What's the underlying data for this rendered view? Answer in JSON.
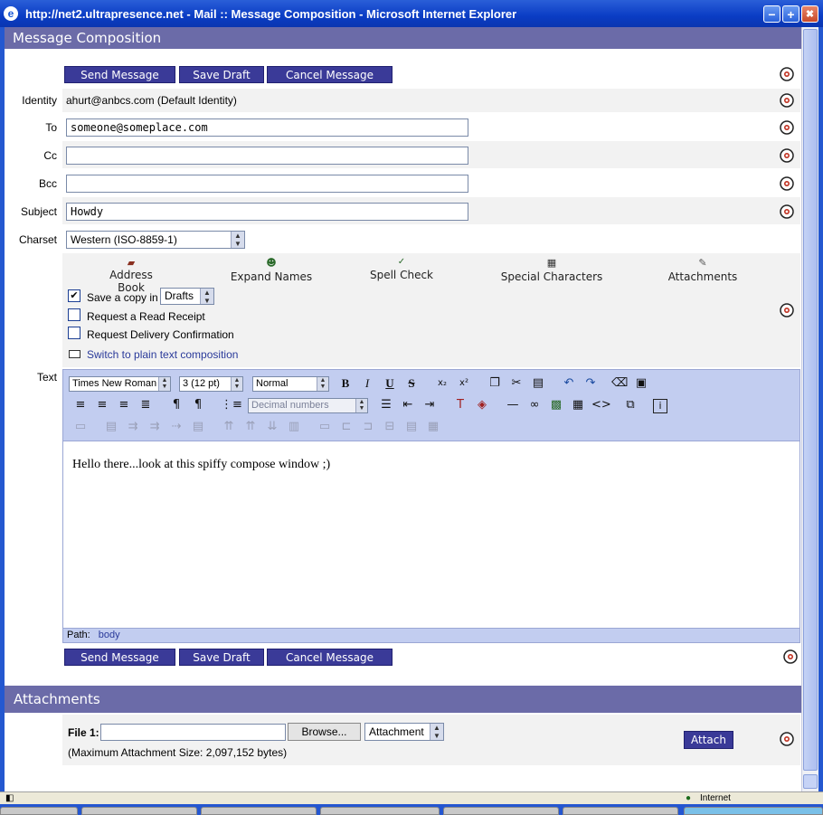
{
  "window": {
    "title": "http://net2.ultrapresence.net - Mail :: Message Composition - Microsoft Internet Explorer",
    "min": "−",
    "max": "+",
    "close": "✖"
  },
  "compose": {
    "header": "Message Composition",
    "buttons": {
      "send": "Send Message",
      "save": "Save Draft",
      "cancel": "Cancel Message"
    },
    "identity_label": "Identity",
    "identity_value": "ahurt@anbcs.com (Default Identity)",
    "to_label": "To",
    "to_value": "someone@someplace.com",
    "cc_label": "Cc",
    "cc_value": "",
    "bcc_label": "Bcc",
    "bcc_value": "",
    "subject_label": "Subject",
    "subject_value": "Howdy",
    "charset_label": "Charset",
    "charset_value": "Western (ISO-8859-1)",
    "tools": {
      "address_book": "Address Book",
      "expand_names": "Expand Names",
      "spell_check": "Spell Check",
      "special_characters": "Special Characters",
      "attachments": "Attachments"
    },
    "options": {
      "save_copy": "Save a copy in",
      "save_copy_folder": "Drafts",
      "read_receipt": "Request a Read Receipt",
      "delivery_confirmation": "Request Delivery Confirmation",
      "plain_text_link": "Switch to plain text composition"
    },
    "text_label": "Text",
    "editor": {
      "font": "Times New Roman",
      "size": "3 (12 pt)",
      "style": "Normal",
      "list_style": "Decimal numbers",
      "body": "Hello there...look at this spiffy compose window ;)",
      "path_label": "Path:",
      "path_value": "body"
    }
  },
  "attachments": {
    "header": "Attachments",
    "file_label": "File 1:",
    "browse": "Browse...",
    "disposition": "Attachment",
    "attach": "Attach",
    "max_size": "(Maximum Attachment Size: 2,097,152 bytes)"
  },
  "statusbar": {
    "zone": "Internet"
  },
  "colors": {
    "section_header": "#6b6ba8",
    "button": "#3a3a98",
    "toolbar": "#c2cdf0",
    "link": "#2a3a9a"
  }
}
